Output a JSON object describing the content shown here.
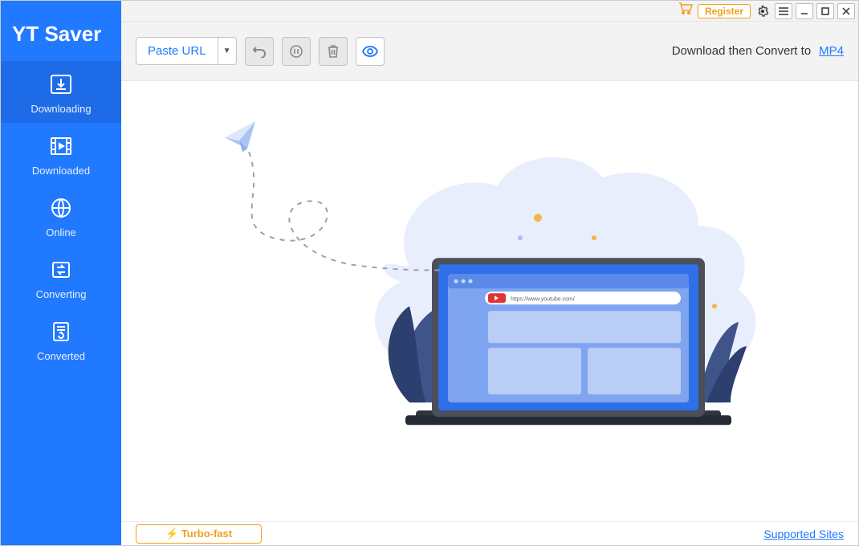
{
  "app_title": "YT Saver",
  "titlebar": {
    "register_label": "Register"
  },
  "sidebar": {
    "items": [
      {
        "label": "Downloading",
        "icon": "download-icon"
      },
      {
        "label": "Downloaded",
        "icon": "filmstrip-icon"
      },
      {
        "label": "Online",
        "icon": "globe-icon"
      },
      {
        "label": "Converting",
        "icon": "convert-icon"
      },
      {
        "label": "Converted",
        "icon": "document-refresh-icon"
      }
    ]
  },
  "toolbar": {
    "paste_url_label": "Paste URL",
    "convert_prefix": "Download then Convert to",
    "format": "MP4"
  },
  "illustration": {
    "browser_url": "https://www.youtube.com/"
  },
  "footer": {
    "turbo_label": "Turbo-fast",
    "supported_sites_label": "Supported Sites"
  },
  "colors": {
    "primary": "#2179ff",
    "accent": "#f0a020"
  }
}
